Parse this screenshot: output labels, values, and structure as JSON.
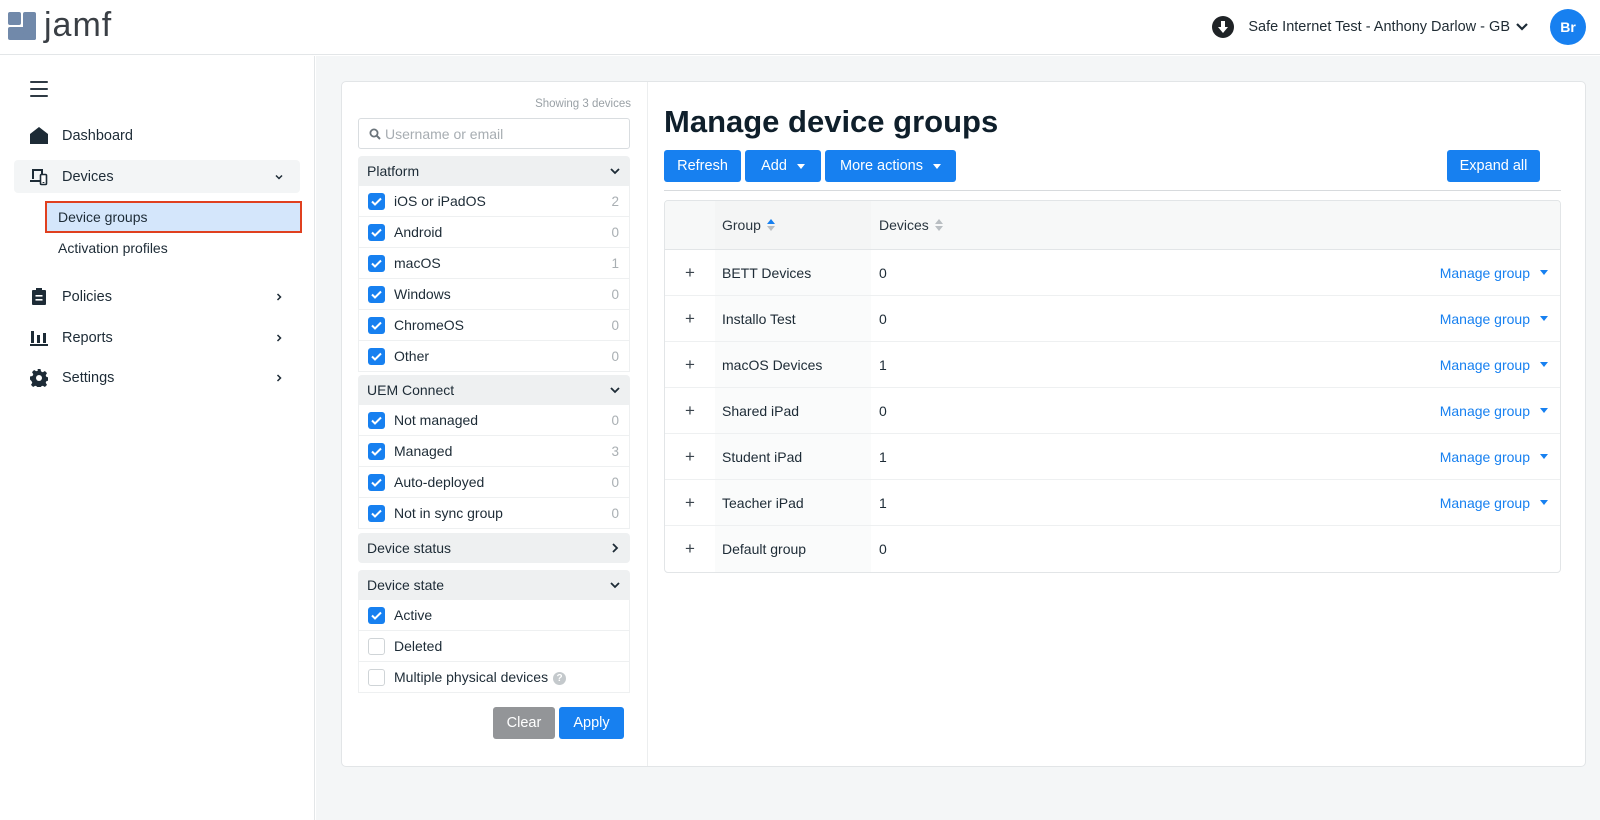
{
  "app": {
    "logo_text": "jamf"
  },
  "header": {
    "org_name": "Safe Internet Test - Anthony Darlow - GB",
    "avatar_initials": "Br"
  },
  "sidebar": {
    "items": [
      {
        "label": "Dashboard",
        "icon": "home-icon"
      },
      {
        "label": "Devices",
        "icon": "devices-icon",
        "expanded": true,
        "children": [
          {
            "label": "Device groups",
            "selected": true
          },
          {
            "label": "Activation profiles"
          }
        ]
      },
      {
        "label": "Policies",
        "icon": "clipboard-icon"
      },
      {
        "label": "Reports",
        "icon": "bar-chart-icon"
      },
      {
        "label": "Settings",
        "icon": "gear-icon"
      }
    ]
  },
  "filters": {
    "showing": "Showing 3 devices",
    "search_placeholder": "Username or email",
    "groups": [
      {
        "title": "Platform",
        "expanded": true,
        "options": [
          {
            "label": "iOS or iPadOS",
            "count": "2",
            "checked": true
          },
          {
            "label": "Android",
            "count": "0",
            "checked": true
          },
          {
            "label": "macOS",
            "count": "1",
            "checked": true
          },
          {
            "label": "Windows",
            "count": "0",
            "checked": true
          },
          {
            "label": "ChromeOS",
            "count": "0",
            "checked": true
          },
          {
            "label": "Other",
            "count": "0",
            "checked": true
          }
        ]
      },
      {
        "title": "UEM Connect",
        "expanded": true,
        "options": [
          {
            "label": "Not managed",
            "count": "0",
            "checked": true
          },
          {
            "label": "Managed",
            "count": "3",
            "checked": true
          },
          {
            "label": "Auto-deployed",
            "count": "0",
            "checked": true
          },
          {
            "label": "Not in sync group",
            "count": "0",
            "checked": true
          }
        ]
      },
      {
        "title": "Device status",
        "expanded": false,
        "options": []
      },
      {
        "title": "Device state",
        "expanded": true,
        "options": [
          {
            "label": "Active",
            "checked": true
          },
          {
            "label": "Deleted",
            "checked": false
          },
          {
            "label": "Multiple physical devices",
            "checked": false,
            "help": true
          }
        ]
      }
    ],
    "clear_label": "Clear",
    "apply_label": "Apply"
  },
  "main": {
    "title": "Manage device groups",
    "toolbar": {
      "refresh_label": "Refresh",
      "add_label": "Add",
      "more_actions_label": "More actions",
      "expand_all_label": "Expand all"
    },
    "table": {
      "columns": [
        "Group",
        "Devices"
      ],
      "sort_column": "Group",
      "sort_direction": "ascending",
      "rows": [
        {
          "group": "BETT Devices",
          "devices": "0",
          "action": "Manage group"
        },
        {
          "group": "Installo Test",
          "devices": "0",
          "action": "Manage group"
        },
        {
          "group": "macOS Devices",
          "devices": "1",
          "action": "Manage group"
        },
        {
          "group": "Shared iPad",
          "devices": "0",
          "action": "Manage group"
        },
        {
          "group": "Student iPad",
          "devices": "1",
          "action": "Manage group"
        },
        {
          "group": "Teacher iPad",
          "devices": "1",
          "action": "Manage group"
        },
        {
          "group": "Default group",
          "devices": "0",
          "action": null
        }
      ]
    }
  },
  "colors": {
    "accent": "#1780f0",
    "selected_bg": "#d4e6fb",
    "highlight_border": "#e0401f",
    "clear_button": "#939598"
  }
}
